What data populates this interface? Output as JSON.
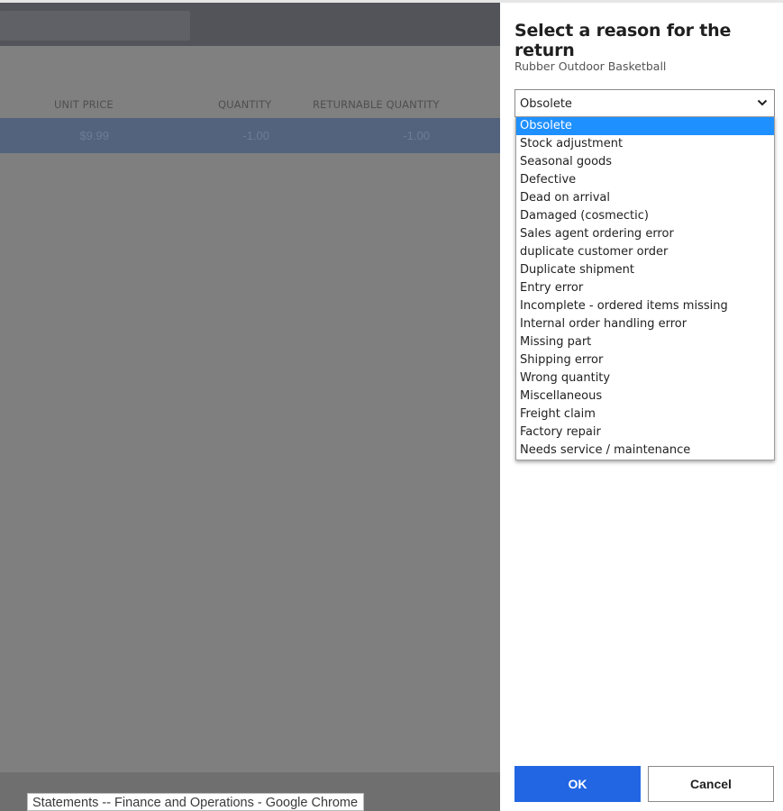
{
  "background": {
    "columns": {
      "unit_price": "UNIT PRICE",
      "quantity": "QUANTITY",
      "returnable_quantity": "RETURNABLE QUANTITY"
    },
    "row": {
      "unit_price": "$9.99",
      "quantity": "-1.00",
      "returnable_quantity": "-1.00"
    }
  },
  "tooltip": "Statements -- Finance and Operations - Google Chrome",
  "dialog": {
    "title": "Select a reason for the return",
    "product_name": "Rubber Outdoor Basketball",
    "reason_select": {
      "value": "Obsolete",
      "chevron_icon": "chevron-down-icon",
      "options": [
        "Obsolete",
        "Stock adjustment",
        "Seasonal goods",
        "Defective",
        "Dead on arrival",
        "Damaged (cosmectic)",
        "Sales agent ordering error",
        "duplicate customer order",
        "Duplicate shipment",
        "Entry error",
        "Incomplete - ordered items missing",
        "Internal order handling error",
        "Missing part",
        "Shipping error",
        "Wrong quantity",
        "Miscellaneous",
        "Freight claim",
        "Factory repair",
        "Needs service / maintenance"
      ],
      "highlighted_index": 0
    },
    "ok_label": "OK",
    "cancel_label": "Cancel"
  },
  "colors": {
    "accent": "#2266e3",
    "selected_option": "#1e90ff",
    "overlay": "#7f7f7f"
  }
}
